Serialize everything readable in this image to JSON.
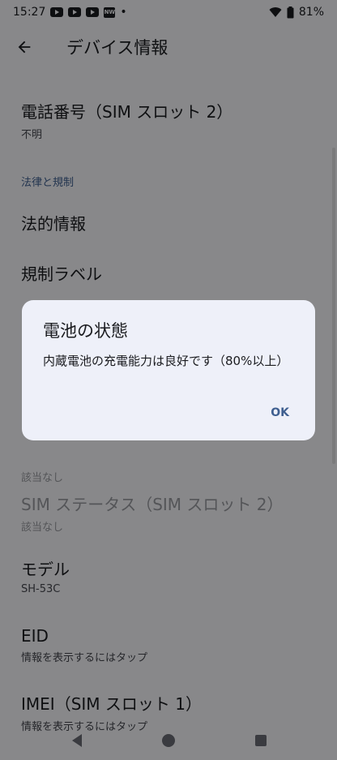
{
  "status_bar": {
    "time": "15:27",
    "notification_icons": [
      "youtube-icon",
      "youtube-icon",
      "youtube-icon",
      "nw-app-icon",
      "dot-icon"
    ],
    "battery": "81%"
  },
  "app_bar": {
    "title": "デバイス情報"
  },
  "list": {
    "phone_number": {
      "title": "電話番号（SIM スロット 2）",
      "summary": "不明"
    },
    "category_legal": "法律と規制",
    "legal_info": {
      "title": "法的情報"
    },
    "regulatory_labels": {
      "title": "規制ラベル"
    },
    "sim_status_1": {
      "summary": "該当なし"
    },
    "sim_status_2": {
      "title": "SIM ステータス（SIM スロット 2）",
      "summary": "該当なし"
    },
    "model": {
      "title": "モデル",
      "summary": "SH-53C"
    },
    "eid": {
      "title": "EID",
      "summary": "情報を表示するにはタップ"
    },
    "imei_1": {
      "title": "IMEI（SIM スロット 1）",
      "summary": "情報を表示するにはタップ"
    }
  },
  "dialog": {
    "title": "電池の状態",
    "message": "内蔵電池の充電能力は良好です（80%以上）",
    "ok_label": "OK"
  },
  "colors": {
    "accent": "#3f5f90",
    "dialog_bg": "#eef0f9",
    "scrim": "rgba(0,0,0,0.45)"
  }
}
